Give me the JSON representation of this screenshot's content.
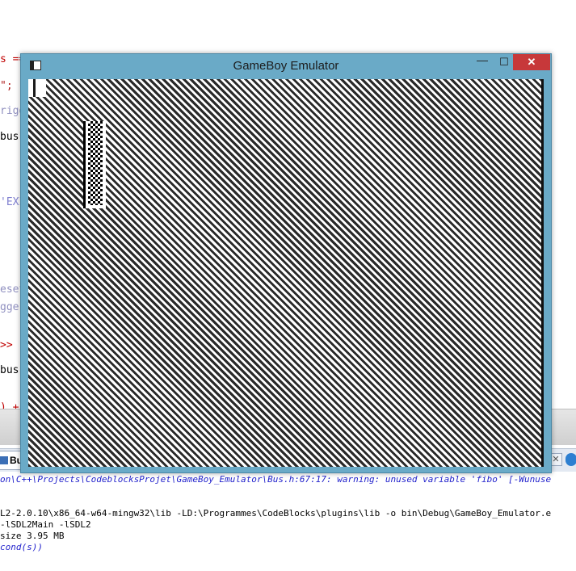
{
  "background_ide": {
    "code_fragments": [
      {
        "text": "s ==",
        "color": "#c00000"
      },
      {
        "text": "\";",
        "color": "#b02020"
      },
      {
        "text": "rigg",
        "color": "#9090c0"
      },
      {
        "text": "bus",
        "color": "#000000"
      },
      {
        "text": "'EXI",
        "color": "#8080d0"
      },
      {
        "text": "eset",
        "color": "#9090c0"
      },
      {
        "text": "gger",
        "color": "#9090c0"
      },
      {
        "text": ">>",
        "color": "#c00000"
      },
      {
        "text": "bus",
        "color": "#000000"
      },
      {
        "text": ") +",
        "color": "#c00000"
      }
    ],
    "tab_label": "Buil",
    "tab_close_glyph": "✕",
    "log_lines": [
      {
        "text": "on\\C++\\Projects\\CodeblocksProjet\\GameBoy_Emulator\\Bus.h:67:17: warning: unused variable 'fibo' [-Wunuse",
        "kind": "warn"
      },
      {
        "text": "L2-2.0.10\\x86_64-w64-mingw32\\lib -LD:\\Programmes\\CodeBlocks\\plugins\\lib -o bin\\Debug\\GameBoy_Emulator.e",
        "kind": "plain"
      },
      {
        "text": " -lSDL2Main -lSDL2",
        "kind": "plain"
      },
      {
        "text": "size 3.95 MB",
        "kind": "plain"
      },
      {
        "text": "cond(s))",
        "kind": "time"
      }
    ]
  },
  "window": {
    "title": "GameBoy Emulator",
    "icon": "app-window-icon",
    "controls": {
      "minimize": "—",
      "maximize": "☐",
      "close": "✕"
    },
    "titlebar_color": "#6aaac7",
    "close_color": "#c7383a"
  },
  "screen": {
    "pattern": "diagonal-stripes",
    "stripe_colors": [
      "#2a2a2a",
      "#ffffff"
    ],
    "sprite": "checkered-sprite"
  }
}
